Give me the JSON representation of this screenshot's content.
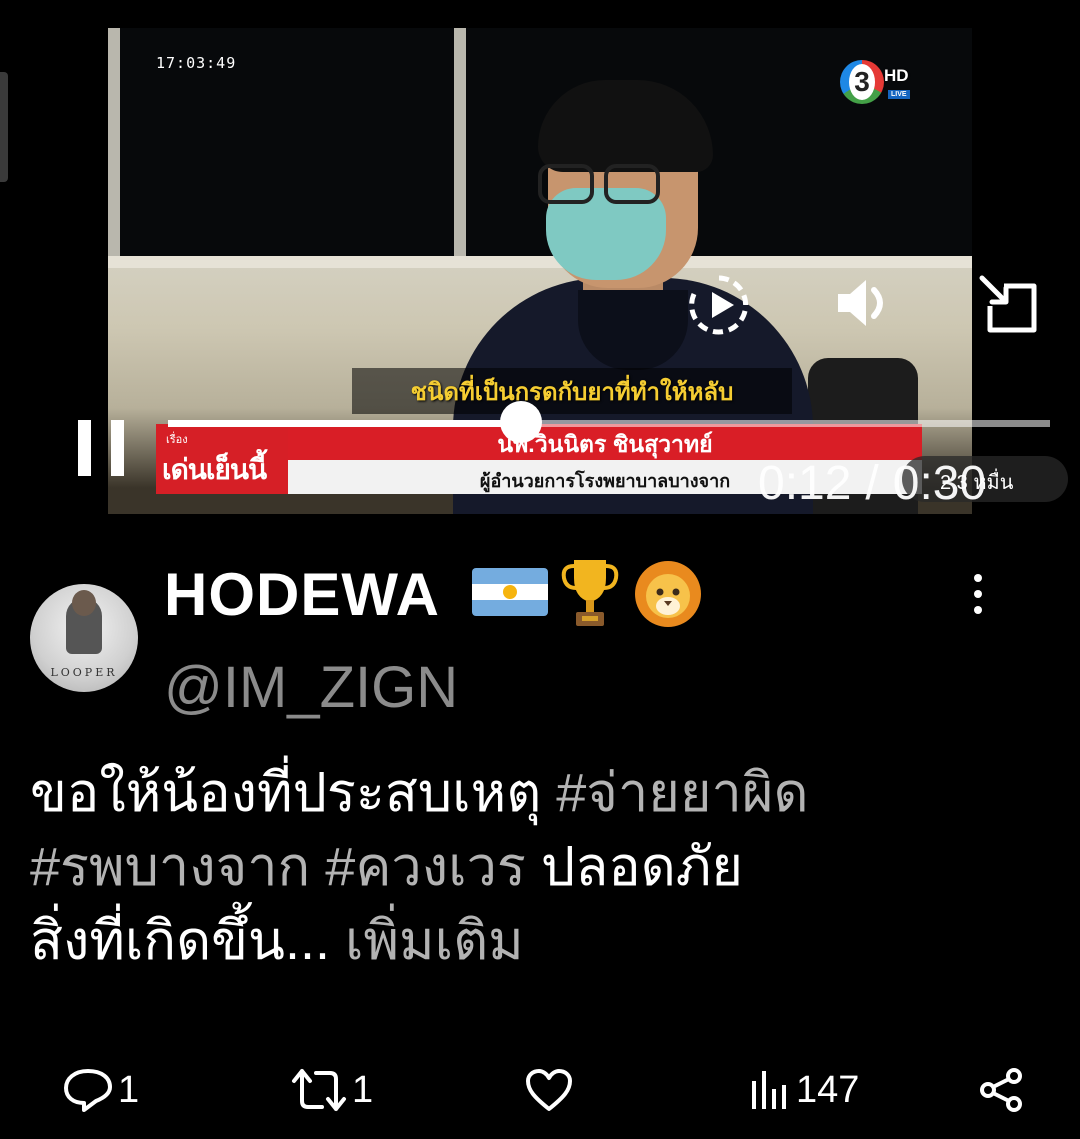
{
  "video": {
    "timestamp": "17:03:49",
    "channel": {
      "number": "3",
      "hd": "HD",
      "live": "LIVE"
    },
    "subtitle": "ชนิดที่เป็นกรดกับยาที่ทำให้หลับ",
    "lower_third": {
      "show_small": "เรื่อง",
      "show_name": "เด่นเย็นนี้",
      "person_name": "นพ.วินนิตร ชินสุวาทย์",
      "person_title": "ผู้อำนวยการโรงพยาบาลบางจาก"
    },
    "current_time": "0:12",
    "separator": "/",
    "duration": "0:30",
    "progress": 0.4,
    "views_pill": "2.3 หมื่น"
  },
  "tweet": {
    "display_name": "HODEWA",
    "handle": "@IM_ZIGN",
    "avatar_caption": "LOOPER",
    "text_plain_1": "ขอให้น้องที่ประสบเหตุ ",
    "tag_1": "#จ่ายยาผิด",
    "tag_2": "#รพบางจาก",
    "tag_3": "#ควงเวร",
    "text_plain_2": "  ปลอดภัย",
    "text_plain_3": "สิ่งที่เกิดขึ้น... ",
    "more_label": "เพิ่มเติม"
  },
  "actions": {
    "replies": "1",
    "reposts": "1",
    "likes": "",
    "views": "147"
  },
  "colors": {
    "background": "#000000",
    "secondary_text": "#8b8b8b",
    "hashtag": "#b3b3b3",
    "lower_third_red": "#d91e26",
    "subtitle_yellow": "#f5cd32"
  },
  "icons": [
    "replay-icon",
    "volume-icon",
    "popout-icon",
    "pause-icon",
    "more-vertical-icon",
    "reply-icon",
    "repost-icon",
    "like-icon",
    "views-icon",
    "share-icon",
    "argentina-flag-emoji",
    "trophy-emoji",
    "lion-emoji"
  ]
}
